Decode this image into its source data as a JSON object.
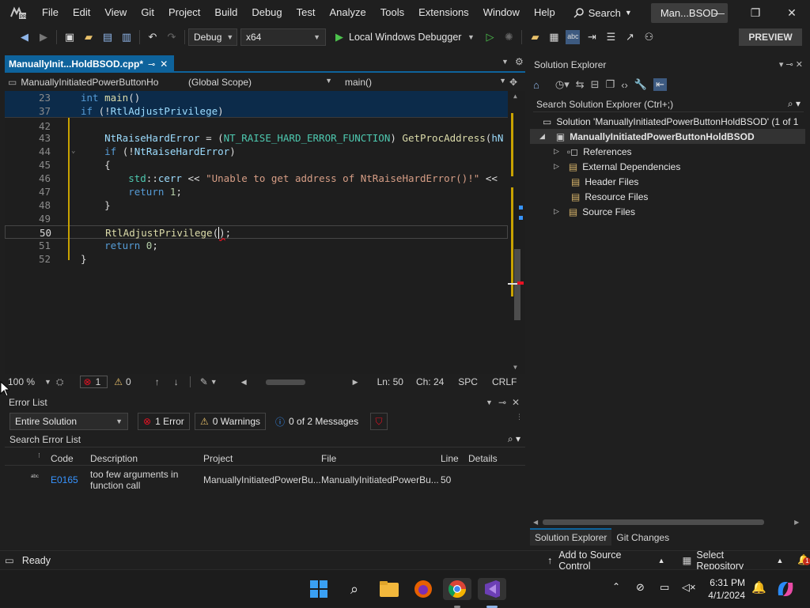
{
  "menu": [
    "File",
    "Edit",
    "View",
    "Git",
    "Project",
    "Build",
    "Debug",
    "Test",
    "Analyze",
    "Tools",
    "Extensions",
    "Window",
    "Help"
  ],
  "search_label": "Search",
  "solution_short": "Man...BSOD",
  "toolbar": {
    "config": "Debug",
    "platform": "x64",
    "debugger": "Local Windows Debugger",
    "preview": "PREVIEW"
  },
  "editor": {
    "tab_title": "ManuallyInit...HoldBSOD.cpp*",
    "nav_project": "ManuallyInitiatedPowerButtonHo",
    "nav_scope": "(Global Scope)",
    "nav_function": "main()",
    "sticky": [
      {
        "n": "23",
        "t": "int main()"
      },
      {
        "n": "37",
        "t": "    if (!RtlAdjustPrivilege)"
      }
    ],
    "lines": [
      {
        "n": "42",
        "t": ""
      },
      {
        "n": "43",
        "t": "    NtRaiseHardError = (NT_RAISE_HARD_ERROR_FUNCTION) GetProcAddress(hN"
      },
      {
        "n": "44",
        "t": "    if (!NtRaiseHardError)"
      },
      {
        "n": "45",
        "t": "    {"
      },
      {
        "n": "46",
        "t": "        std::cerr << \"Unable to get address of NtRaiseHardError()!\" <<"
      },
      {
        "n": "47",
        "t": "        return 1;"
      },
      {
        "n": "48",
        "t": "    }"
      },
      {
        "n": "49",
        "t": ""
      },
      {
        "n": "50",
        "t": "    RtlAdjustPrivilege();"
      },
      {
        "n": "51",
        "t": "    return 0;"
      },
      {
        "n": "52",
        "t": "}"
      }
    ],
    "zoom": "100 %",
    "errors": "1",
    "warnings": "0",
    "ln": "Ln: 50",
    "ch": "Ch: 24",
    "spc": "SPC",
    "crlf": "CRLF"
  },
  "error_list": {
    "title": "Error List",
    "scope": "Entire Solution",
    "errors_btn": "1 Error",
    "warnings_btn": "0 Warnings",
    "messages_btn": "0 of 2 Messages",
    "search_placeholder": "Search Error List",
    "columns": [
      "Code",
      "Description",
      "Project",
      "File",
      "Line",
      "Details"
    ],
    "rows": [
      {
        "code": "E0165",
        "desc_1": "too few arguments in",
        "desc_2": "function call",
        "project": "ManuallyInitiatedPowerBu...",
        "file": "ManuallyInitiatedPowerBu...",
        "line": "50"
      }
    ]
  },
  "solution_explorer": {
    "title": "Solution Explorer",
    "search_placeholder": "Search Solution Explorer (Ctrl+;)",
    "solution": "Solution 'ManuallyInitiatedPowerButtonHoldBSOD' (1 of 1",
    "project": "ManuallyInitiatedPowerButtonHoldBSOD",
    "items": [
      "References",
      "External Dependencies",
      "Header Files",
      "Resource Files",
      "Source Files"
    ],
    "tabs": [
      "Solution Explorer",
      "Git Changes"
    ]
  },
  "statusbar": {
    "ready": "Ready",
    "add_source": "Add to Source Control",
    "select_repo": "Select Repository",
    "notif_count": "1"
  },
  "taskbar": {
    "time": "6:31 PM",
    "date": "4/1/2024"
  },
  "colors": {
    "accent": "#0e639c",
    "error": "#e81123",
    "vs_purple": "#6c3fb5"
  }
}
